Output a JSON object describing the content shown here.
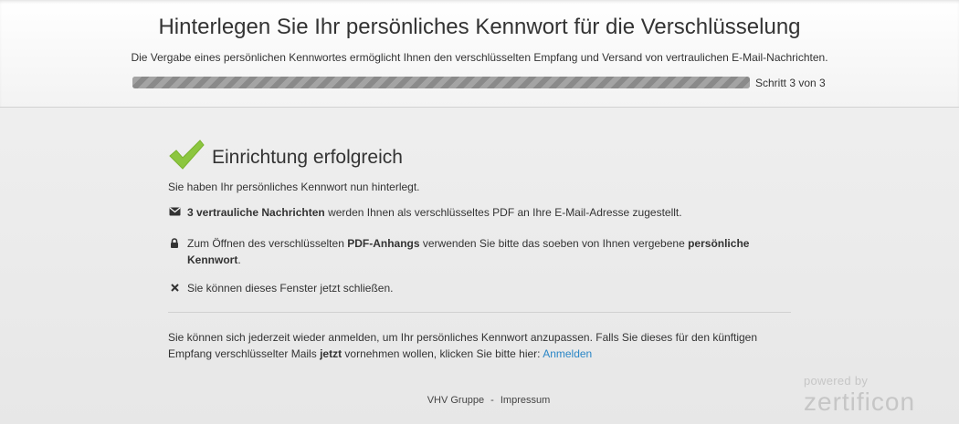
{
  "header": {
    "title": "Hinterlegen Sie Ihr persönliches Kennwort für die Verschlüsselung",
    "subtitle": "Die Vergabe eines persönlichen Kennwortes ermöglicht Ihnen den verschlüsselten Empfang und Versand von vertraulichen E-Mail-Nachrichten.",
    "progress_fraction": 1.0,
    "step_label": "Schritt 3 von 3"
  },
  "result": {
    "title": "Einrichtung erfolgreich",
    "intro": "Sie haben Ihr persönliches Kennwort nun hinterlegt.",
    "items": [
      {
        "icon": "envelope-icon",
        "bold1": "3 vertrauliche Nachrichten",
        "text1": " werden Ihnen als verschlüsseltes PDF an Ihre E-Mail-Adresse zugestellt."
      },
      {
        "icon": "lock-icon",
        "text1": "Zum Öffnen des verschlüsselten ",
        "bold1": "PDF-Anhangs",
        "text2": " verwenden Sie bitte das soeben von Ihnen vergebene ",
        "bold2": "persönliche Kennwort",
        "text3": "."
      },
      {
        "icon": "close-icon",
        "text1": "Sie können dieses Fenster jetzt schließen."
      }
    ],
    "footer_part1": "Sie können sich jederzeit wieder anmelden, um Ihr persönliches Kennwort anzupassen. Falls Sie dieses für den künftigen Empfang verschlüsselter Mails ",
    "footer_bold": "jetzt",
    "footer_part2": " vornehmen wollen, klicken Sie bitte hier: ",
    "login_link": "Anmelden"
  },
  "footer": {
    "company": "VHV Gruppe",
    "separator": "-",
    "imprint": "Impressum"
  },
  "branding": {
    "powered_by": "powered by",
    "brand": "zertificon"
  },
  "colors": {
    "check_green": "#8cc63f",
    "link_blue": "#2a86c6",
    "progress_gray": "#8a8a8a"
  }
}
